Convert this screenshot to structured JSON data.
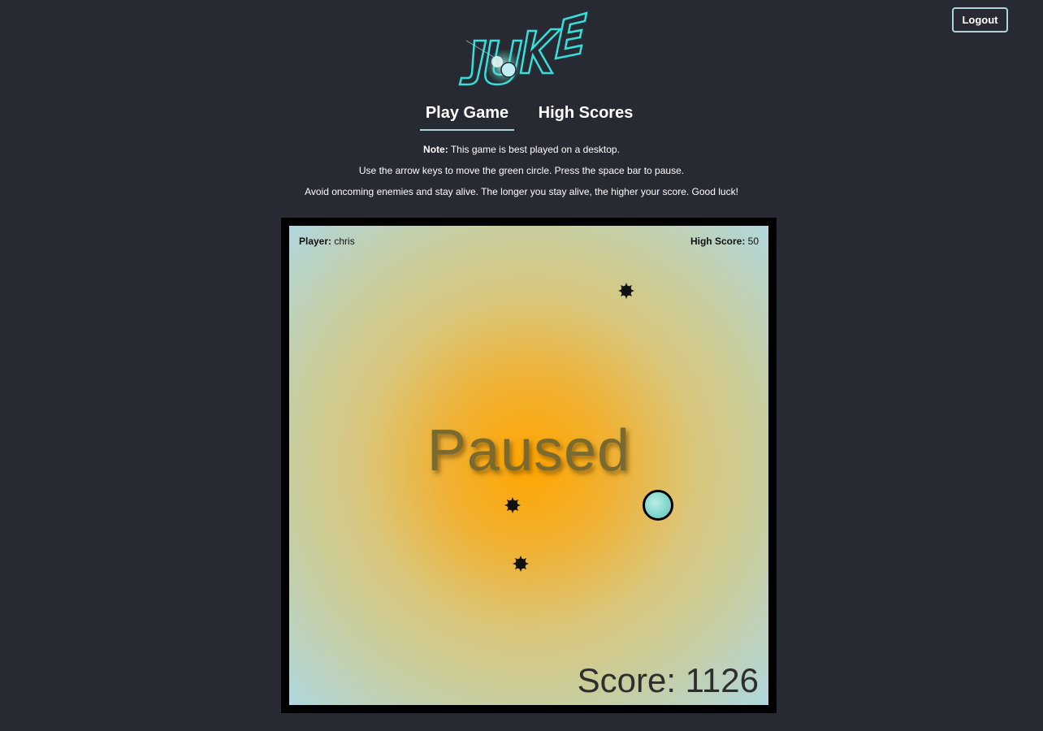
{
  "header": {
    "logout_label": "Logout",
    "logo_text": "JUKE"
  },
  "nav": {
    "tabs": [
      {
        "label": "Play Game",
        "active": true
      },
      {
        "label": "High Scores",
        "active": false
      }
    ]
  },
  "instructions": {
    "note_label": "Note:",
    "note_text": " This game is best played on a desktop.",
    "line2": "Use the arrow keys to move the green circle. Press the space bar to pause.",
    "line3": "Avoid oncoming enemies and stay alive. The longer you stay alive, the higher your score. Good luck!"
  },
  "game": {
    "player_label": "Player:",
    "player_name": " chris",
    "high_score_label": "High Score:",
    "high_score_value": " 50",
    "status_text": "Paused",
    "score_text": "Score: 1126",
    "enemy_count": 3,
    "colors": {
      "accent": "#aed3d8",
      "page_bg": "#272a32",
      "board_center": "#ffa500",
      "board_edge": "#b0d7de",
      "player_fill": "#7fd6cc"
    }
  }
}
